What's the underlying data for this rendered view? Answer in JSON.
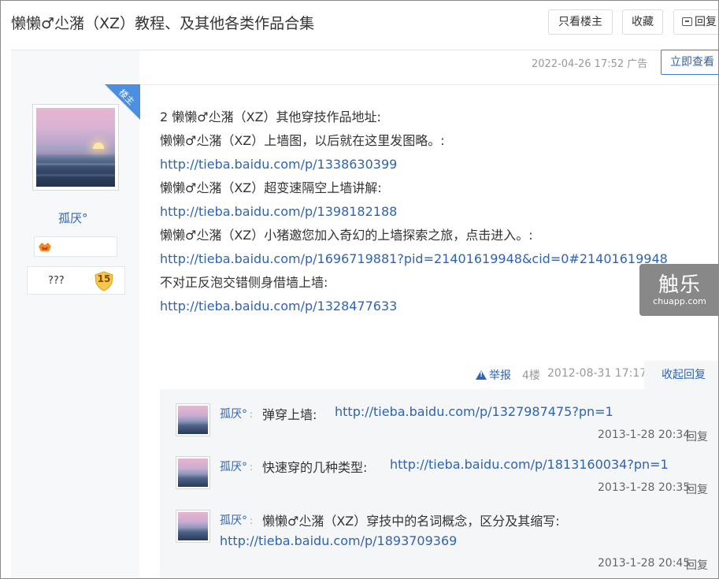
{
  "header": {
    "title": "懒懒♂尐潴（XZ）教程、及其他各类作品合集",
    "only_louzhu": "只看楼主",
    "favorite": "收藏",
    "reply": "回复"
  },
  "meta": {
    "datetime": "2022-04-26 17:52",
    "ad": "广告",
    "view_now": "立即查看"
  },
  "author": {
    "badge": "楼主",
    "username": "孤厌°",
    "level_title": "???",
    "level": "15"
  },
  "post": {
    "lines": [
      {
        "text": "2 懒懒♂尐潴（XZ）其他穿技作品地址:",
        "is_link": false
      },
      {
        "text": "懒懒♂尐潴（XZ）上墙图，以后就在这里发图略。:",
        "is_link": false
      },
      {
        "text": "http://tieba.baidu.com/p/1338630399",
        "is_link": true
      },
      {
        "text": "懒懒♂尐潴（XZ）超变速隔空上墙讲解:",
        "is_link": false
      },
      {
        "text": "http://tieba.baidu.com/p/1398182188",
        "is_link": true
      },
      {
        "text": "懒懒♂尐潴（XZ）小猪邀您加入奇幻的上墙探索之旅，点击进入。:",
        "is_link": false
      },
      {
        "text": "http://tieba.baidu.com/p/1696719881?pid=21401619948&cid=0#21401619948",
        "is_link": true
      },
      {
        "text": "不对正反泡交错侧身借墙上墙:",
        "is_link": false
      },
      {
        "text": "http://tieba.baidu.com/p/1328477633",
        "is_link": true
      }
    ]
  },
  "watermark": {
    "main": "触乐",
    "sub": "chuapp.com"
  },
  "floor": {
    "report": "举报",
    "floor_no": "4楼",
    "datetime": "2012-08-31 17:17",
    "collapse": "收起回复"
  },
  "comments": [
    {
      "user": "孤厌°",
      "colon": ":",
      "text": "弹穿上墙:",
      "link": "http://tieba.baidu.com/p/1327987475?pn=1",
      "time": "2013-1-28 20:34",
      "reply": "回复"
    },
    {
      "user": "孤厌°",
      "colon": ":",
      "text": "快速穿的几种类型:",
      "link": "http://tieba.baidu.com/p/1813160034?pn=1",
      "time": "2013-1-28 20:35",
      "reply": "回复"
    },
    {
      "user": "孤厌°",
      "colon": ":",
      "text": "懒懒♂尐潴（XZ）穿技中的名词概念，区分及其缩写:",
      "link": "http://tieba.baidu.com/p/1893709369",
      "time": "2013-1-28 20:45",
      "reply": "回复"
    }
  ]
}
